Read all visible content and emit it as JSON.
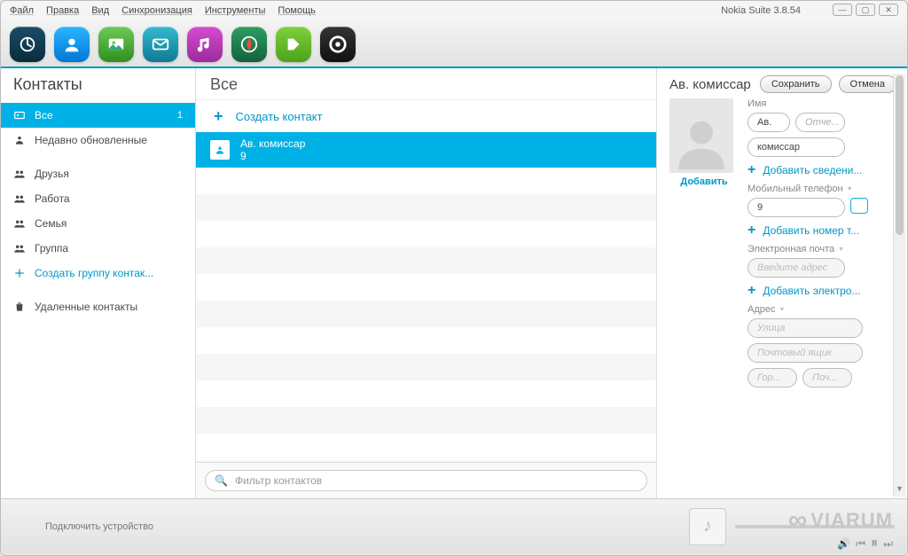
{
  "app_title": "Nokia Suite 3.8.54",
  "menu": [
    "Файл",
    "Правка",
    "Вид",
    "Синхронизация",
    "Инструменты",
    "Помощь"
  ],
  "toolbar_icons": [
    "home",
    "contacts",
    "gallery",
    "messages",
    "music",
    "maps",
    "apps",
    "support"
  ],
  "sidebar": {
    "title": "Контакты",
    "items": [
      {
        "label": "Все",
        "count": "1",
        "icon": "card",
        "active": true
      },
      {
        "label": "Недавно обновленные",
        "icon": "person"
      },
      {
        "label": "Друзья",
        "icon": "group",
        "sep": true
      },
      {
        "label": "Работа",
        "icon": "group"
      },
      {
        "label": "Семья",
        "icon": "group"
      },
      {
        "label": "Группа",
        "icon": "group"
      },
      {
        "label": "Создать группу контак...",
        "icon": "plus",
        "teal": true
      },
      {
        "label": "Удаленные контакты",
        "icon": "trash",
        "sep": true
      }
    ]
  },
  "middle": {
    "header": "Все",
    "create": "Создать контакт",
    "contact": {
      "name": "Ав. комиссар",
      "sub": "9"
    },
    "filter_placeholder": "Фильтр контактов"
  },
  "detail": {
    "title": "Ав. комиссар",
    "save": "Сохранить",
    "cancel": "Отмена",
    "name_label": "Имя",
    "first": "Ав.",
    "patronymic_ph": "Отче...",
    "last": "комиссар",
    "add_info": "Добавить сведени...",
    "mobile_label": "Мобильный телефон",
    "mobile": "9",
    "add_number": "Добавить номер т...",
    "email_label": "Электронная почта",
    "email_ph": "Введите адрес",
    "add_email": "Добавить электро...",
    "address_label": "Адрес",
    "street_ph": "Улица",
    "pobox_ph": "Почтовый ящик",
    "city_ph": "Гор...",
    "postcode_ph": "Поч...",
    "add_photo": "Добавить"
  },
  "footer": {
    "connect": "Подключить устройство"
  },
  "brand": "VIARUM"
}
